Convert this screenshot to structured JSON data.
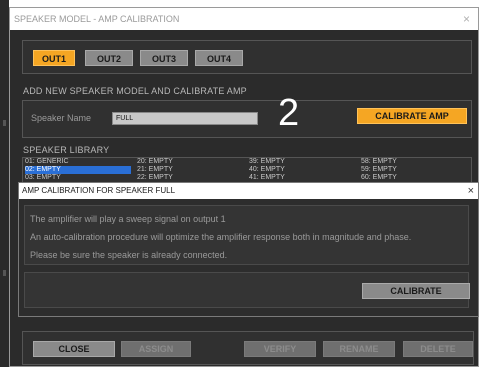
{
  "window": {
    "title": "SPEAKER MODEL - AMP CALIBRATION",
    "close_glyph": "×"
  },
  "outputs": [
    {
      "label": "OUT1",
      "active": true
    },
    {
      "label": "OUT2",
      "active": false
    },
    {
      "label": "OUT3",
      "active": false
    },
    {
      "label": "OUT4",
      "active": false
    }
  ],
  "add_section": {
    "heading": "ADD NEW SPEAKER MODEL AND CALIBRATE AMP",
    "speaker_name_label": "Speaker Name",
    "speaker_name_value": "FULL",
    "calibrate_amp_label": "CALIBRATE AMP"
  },
  "annotation_number": "2",
  "library": {
    "heading": "SPEAKER LIBRARY",
    "col1": [
      "01: GENERIC",
      "02: EMPTY",
      "03: EMPTY"
    ],
    "col2": [
      "20: EMPTY",
      "21: EMPTY",
      "22: EMPTY"
    ],
    "col3": [
      "39: EMPTY",
      "40: EMPTY",
      "41: EMPTY"
    ],
    "col4": [
      "58: EMPTY",
      "59: EMPTY",
      "60: EMPTY"
    ],
    "selected": "02: EMPTY"
  },
  "dialog": {
    "title": "AMP CALIBRATION FOR SPEAKER FULL",
    "close_glyph": "×",
    "lines": [
      "The amplifier will play a sweep signal on output 1",
      "An auto-calibration procedure will optimize the amplifier response both in magnitude and phase.",
      "Please be sure the speaker is already connected."
    ],
    "calibrate_label": "CALIBRATE"
  },
  "bottom": {
    "close_label": "CLOSE",
    "assign_label": "ASSIGN",
    "verify_label": "VERIFY",
    "rename_label": "RENAME",
    "delete_label": "DELETE"
  },
  "colors": {
    "accent": "#f5a623",
    "selection": "#2a6fd6",
    "panel": "#2b2b2b"
  }
}
